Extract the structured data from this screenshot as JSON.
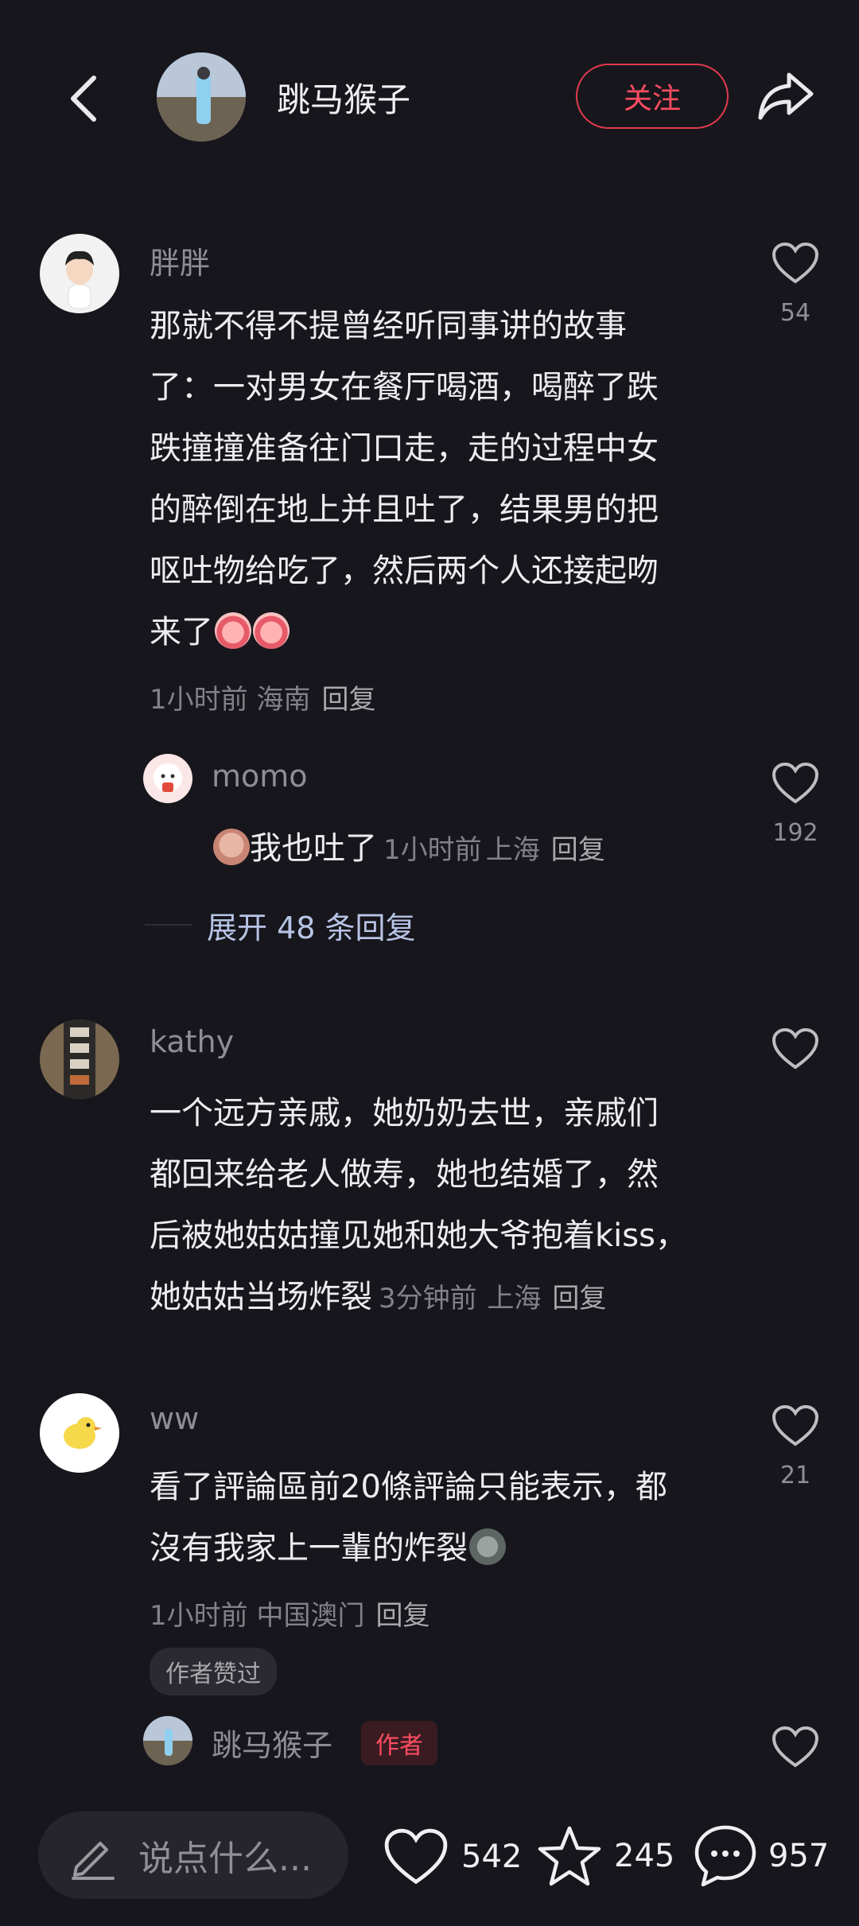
{
  "header": {
    "author_name": "跳马猴子",
    "follow_label": "关注"
  },
  "comments": [
    {
      "user": "胖胖",
      "lines": [
        "那就不得不提曾经听同事讲的故事",
        "了：一对男女在餐厅喝酒，喝醉了跌",
        "跌撞撞准备往门口走，走的过程中女",
        "的醉倒在地上并且吐了，结果男的把",
        "呕吐物给吃了，然后两个人还接起吻",
        "来了"
      ],
      "time": "1小时前",
      "location": "海南",
      "reply_label": "回复",
      "likes": "54",
      "replies": [
        {
          "user": "momo",
          "text": "我也吐了",
          "time": "1小时前",
          "location": "上海",
          "reply_label": "回复",
          "likes": "192"
        }
      ],
      "expand_label": "展开 48 条回复"
    },
    {
      "user": "kathy",
      "lines": [
        "一个远方亲戚，她奶奶去世，亲戚们",
        "都回来给老人做寿，她也结婚了，然",
        "后被她姑姑撞见她和她大爷抱着kiss，",
        "她姑姑当场炸裂"
      ],
      "time": "3分钟前",
      "location": "上海",
      "reply_label": "回复"
    },
    {
      "user": "ww",
      "lines": [
        "看了評論區前20條評論只能表示，都",
        "沒有我家上一輩的炸裂"
      ],
      "time": "1小时前",
      "location": "中国澳门",
      "reply_label": "回复",
      "likes": "21",
      "badge": "作者赞过",
      "replies": [
        {
          "user": "跳马猴子",
          "author_tag": "作者"
        }
      ]
    }
  ],
  "bottom_bar": {
    "input_placeholder": "说点什么...",
    "like_count": "542",
    "favorite_count": "245",
    "comment_count": "957"
  },
  "colors": {
    "background": "#17161c",
    "accent_red": "#ff4d61",
    "expand_blue": "#b8c4e6"
  }
}
